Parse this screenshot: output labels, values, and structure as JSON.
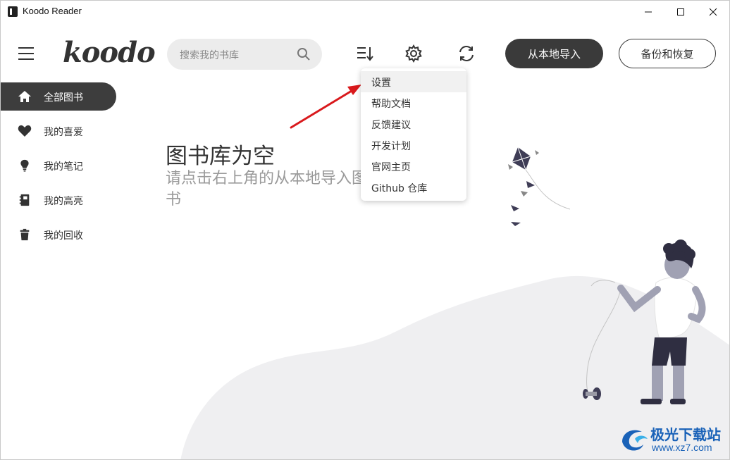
{
  "window": {
    "title": "Koodo Reader"
  },
  "header": {
    "logo": "koodo",
    "search_placeholder": "搜索我的书库",
    "import_label": "从本地导入",
    "backup_label": "备份和恢复"
  },
  "sidebar": {
    "items": [
      {
        "label": "全部图书",
        "icon": "home-icon",
        "active": true
      },
      {
        "label": "我的喜爱",
        "icon": "heart-icon"
      },
      {
        "label": "我的笔记",
        "icon": "lightbulb-icon"
      },
      {
        "label": "我的高亮",
        "icon": "notebook-icon"
      },
      {
        "label": "我的回收",
        "icon": "trash-icon"
      }
    ]
  },
  "empty_state": {
    "title": "图书库为空",
    "subtitle": "请点击右上角的从本地导入图书"
  },
  "menu": {
    "items": [
      "设置",
      "帮助文档",
      "反馈建议",
      "开发计划",
      "官网主页",
      "Github 仓库"
    ]
  },
  "watermark": {
    "name": "极光下载站",
    "url": "www.xz7.com"
  },
  "colors": {
    "accent_dark": "#3a3a3a",
    "arrow": "#d9191c",
    "watermark": "#1a62b8"
  }
}
